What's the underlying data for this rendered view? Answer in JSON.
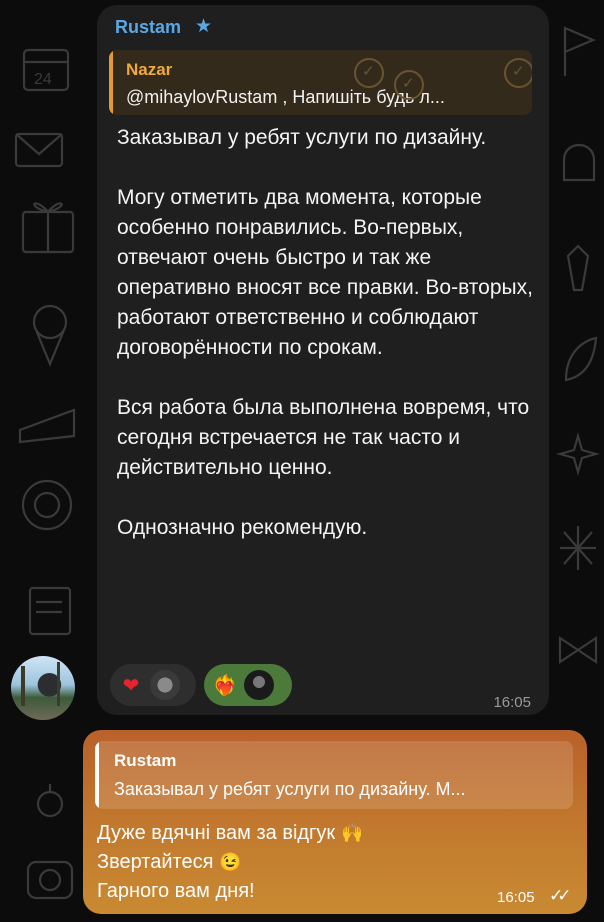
{
  "incoming": {
    "sender": "Rustam",
    "sender_icon": "star-icon",
    "reply": {
      "name": "Nazar",
      "text": "@mihaylovRustam , Напишіть будь л..."
    },
    "paragraphs": [
      "Заказывал у ребят услуги по дизайну.",
      "Могу отметить два момента, которые особенно понравились. Во-первых, отвечают очень быстро и так же оперативно вносят все правки. Во-вторых, работают ответственно и соблюдают договорённости по срокам.",
      "Вся работа была выполнена вовремя, что сегодня встречается не так часто и действительно ценно.",
      "Однозначно рекомендую."
    ],
    "reactions": [
      {
        "emoji": "heart-icon",
        "glyph": "❤"
      },
      {
        "emoji": "heart-on-fire-icon",
        "glyph": "❤‍🔥"
      }
    ],
    "time": "16:05"
  },
  "outgoing": {
    "reply": {
      "name": "Rustam",
      "text": "Заказывал у ребят услуги по дизайну. М..."
    },
    "lines": [
      "Дуже вдячні вам за відгук",
      "Звертайтеся",
      "Гарного вам дня!"
    ],
    "time": "16:05",
    "status_icon": "double-check-icon"
  },
  "colors": {
    "accent_name": "#5aa7e6",
    "reply_orange": "#efaa3c",
    "outgoing_bubble": "#c27a2e",
    "incoming_bubble": "#1f1f1f"
  }
}
